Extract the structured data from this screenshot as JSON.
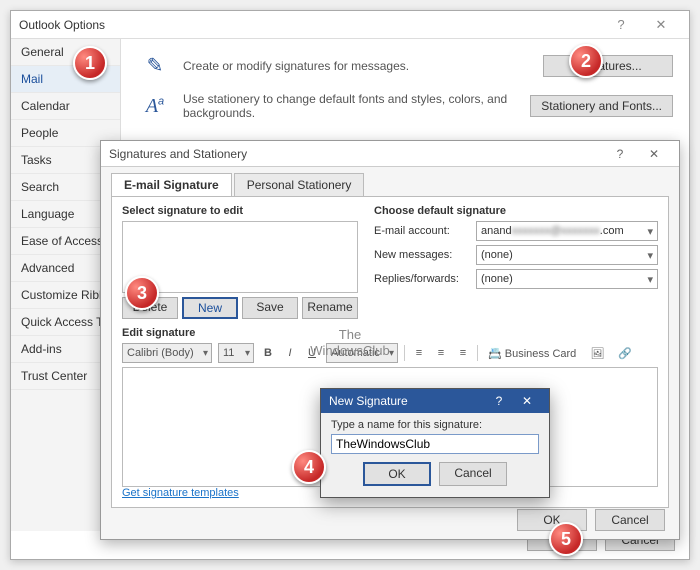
{
  "win1": {
    "title": "Outlook Options",
    "help_icon": "?",
    "close_icon": "✕",
    "sidebar": {
      "items": [
        "General",
        "Mail",
        "Calendar",
        "People",
        "Tasks",
        "Search",
        "Language",
        "Ease of Access",
        "Advanced",
        "Customize Ribb",
        "Quick Access T",
        "Add-ins",
        "Trust Center"
      ],
      "selected_index": 1
    },
    "row1": {
      "text": "Create or modify signatures for messages.",
      "button": "Signatures..."
    },
    "row2": {
      "text": "Use stationery to change default fonts and styles, colors, and backgrounds.",
      "button": "Stationery and Fonts..."
    },
    "ok": "OK",
    "cancel": "Cancel"
  },
  "win2": {
    "title": "Signatures and Stationery",
    "help_icon": "?",
    "close_icon": "✕",
    "tabs": {
      "t1": "E-mail Signature",
      "t2": "Personal Stationery"
    },
    "left": {
      "label": "Select signature to edit",
      "delete": "Delete",
      "new": "New",
      "save": "Save",
      "rename": "Rename"
    },
    "right": {
      "label": "Choose default signature",
      "account_label": "E-mail account:",
      "account_value_prefix": "anand",
      "account_value_suffix": ".com",
      "newmsg_label": "New messages:",
      "newmsg_value": "(none)",
      "replies_label": "Replies/forwards:",
      "replies_value": "(none)"
    },
    "edit": {
      "label": "Edit signature",
      "font": "Calibri (Body)",
      "size": "11",
      "auto": "Automatic",
      "bizcard": "Business Card"
    },
    "link": "Get signature templates",
    "ok": "OK",
    "cancel": "Cancel"
  },
  "win3": {
    "title": "New Signature",
    "help_icon": "?",
    "close_icon": "✕",
    "prompt": "Type a name for this signature:",
    "value": "TheWindowsClub",
    "ok": "OK",
    "cancel": "Cancel"
  },
  "watermark": {
    "line1": "The",
    "line2": "WindowsClub"
  },
  "badges": {
    "1": "1",
    "2": "2",
    "3": "3",
    "4": "4",
    "5": "5"
  }
}
